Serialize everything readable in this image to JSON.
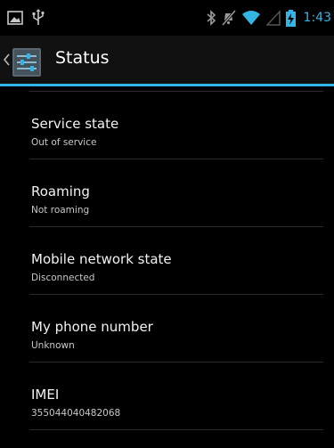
{
  "status_bar": {
    "left_icons": [
      "picture-icon",
      "usb-icon"
    ],
    "right_icons": [
      "bluetooth-icon",
      "mute-icon",
      "wifi-icon",
      "no-signal-icon",
      "battery-charging-icon"
    ],
    "time": "1:43",
    "accent_color": "#33b5e5"
  },
  "action_bar": {
    "title": "Status",
    "up_icon": "chevron-left-icon",
    "app_icon": "settings-sliders-icon"
  },
  "items": [
    {
      "title": "Service state",
      "summary": "Out of service"
    },
    {
      "title": "Roaming",
      "summary": "Not roaming"
    },
    {
      "title": "Mobile network state",
      "summary": "Disconnected"
    },
    {
      "title": "My phone number",
      "summary": "Unknown"
    },
    {
      "title": "IMEI",
      "summary": "355044040482068"
    }
  ]
}
